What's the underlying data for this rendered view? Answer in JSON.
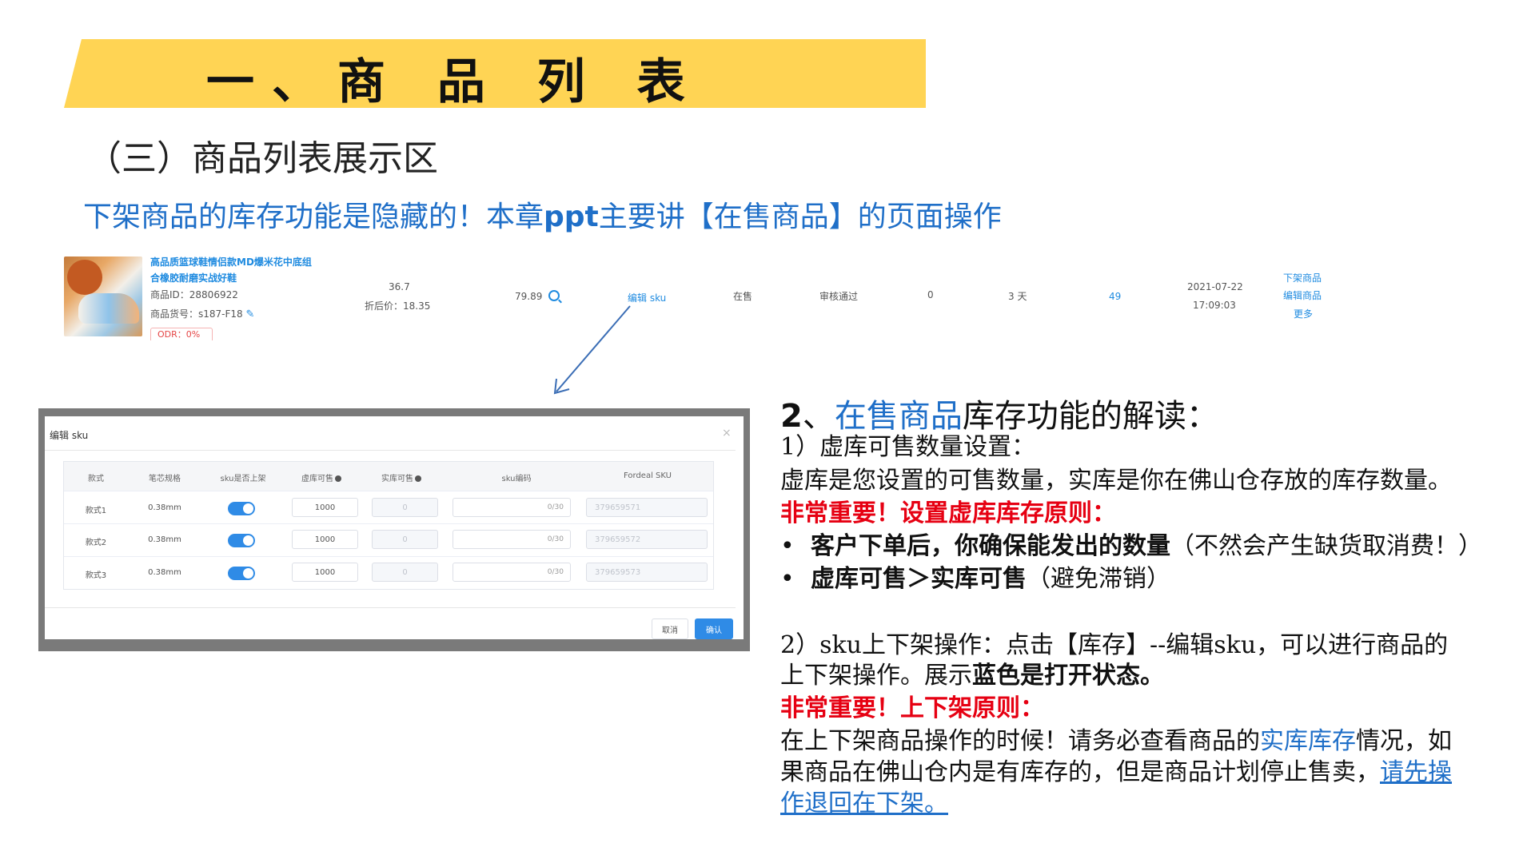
{
  "banner": {
    "title": "一、商 品 列 表"
  },
  "section": {
    "subtitle": "（三）商品列表展示区"
  },
  "note": {
    "pre": "下架商品的库存功能是隐藏的！本章",
    "bold": "ppt",
    "post": "主要讲【在售商品】的页面操作"
  },
  "product": {
    "title_line1": "高品质篮球鞋情侣款MD爆米花中底组",
    "title_line2": "合橡胶耐磨实战好鞋",
    "id_label": "商品ID：",
    "id_value": "28806922",
    "sku_label": "商品货号：",
    "sku_value": "s187-F18",
    "odr": "ODR：0%",
    "price": "36.7",
    "discount": "折后价：18.35",
    "price2": "79.89",
    "edit_sku": "编辑 sku",
    "status": "在售",
    "review": "审核通过",
    "count": "0",
    "days": "3 天",
    "stock_link": "49",
    "date": "2021-07-22",
    "time": "17:09:03",
    "actions": [
      "下架商品",
      "编辑商品",
      "更多"
    ]
  },
  "modal": {
    "title": "编辑 sku",
    "close": "×",
    "headers": [
      "款式",
      "笔芯规格",
      "sku是否上架",
      "虚库可售",
      "实库可售",
      "sku编码",
      "Fordeal SKU"
    ],
    "rows": [
      {
        "style": "款式1",
        "spec": "0.38mm",
        "virtual": "1000",
        "real": "0",
        "code_count": "0/30",
        "fordeal": "379659571"
      },
      {
        "style": "款式2",
        "spec": "0.38mm",
        "virtual": "1000",
        "real": "0",
        "code_count": "0/30",
        "fordeal": "379659572"
      },
      {
        "style": "款式3",
        "spec": "0.38mm",
        "virtual": "1000",
        "real": "0",
        "code_count": "0/30",
        "fordeal": "379659573"
      }
    ],
    "cancel": "取消",
    "confirm": "确认"
  },
  "explain": {
    "heading_num": "2",
    "heading_sep": "、",
    "heading_blue": "在售商品",
    "heading_rest": "库存功能的解读：",
    "p1": "1）虚库可售数量设置：",
    "p2": "虚库是您设置的可售数量，实库是你在佛山仓存放的库存数量。",
    "p3": "非常重要！设置虚库库存原则：",
    "b1_bold": "客户下单后，你确保能发出的数量",
    "b1_rest": "（不然会产生缺货取消费！）",
    "b2_bold": "虚库可售＞实库可售",
    "b2_rest": "（避免滞销）",
    "p4": "2）sku上下架操作：点击【库存】--编辑sku，可以进行商品的",
    "p5_a": "上下架操作。展示",
    "p5_b": "蓝色是打开状态。",
    "p6": "非常重要！上下架原则：",
    "p7_a": "在上下架商品操作的时候！请务必查看商品的",
    "p7_blue": "实库库存",
    "p7_b": "情况，如",
    "p8_a": "果商品在佛山仓内是有库存的，但是商品计划停止售卖，",
    "p8_link": "请先操",
    "p9_link": "作退回在下架。"
  },
  "colors": {
    "banner": "#ffd454",
    "blue": "#1f6fc8",
    "red": "#e60012",
    "toggle_on": "#2f8be6"
  }
}
